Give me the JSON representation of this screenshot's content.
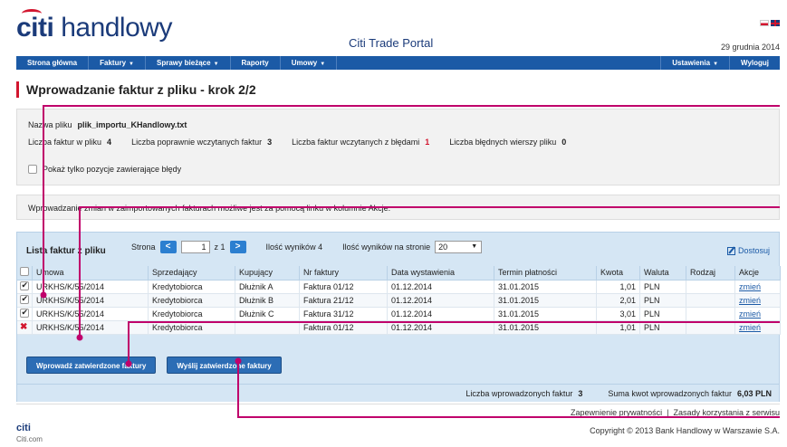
{
  "header": {
    "logo_citi": "citi",
    "logo_rest": " handlowy",
    "portal_title": "Citi Trade Portal",
    "date": "29 grudnia 2014"
  },
  "nav": {
    "items": [
      "Strona główna",
      "Faktury",
      "Sprawy bieżące",
      "Raporty",
      "Umowy"
    ],
    "dropdown": [
      false,
      true,
      true,
      false,
      true
    ],
    "right_items": [
      "Ustawienia",
      "Wyloguj"
    ],
    "right_dropdown": [
      true,
      false
    ]
  },
  "page_title": "Wprowadzanie faktur z pliku - krok 2/2",
  "file_info": {
    "name_label": "Nazwa pliku",
    "name_value": "plik_importu_KHandlowy.txt",
    "stats": [
      {
        "label": "Liczba faktur w pliku",
        "value": "4"
      },
      {
        "label": "Liczba poprawnie wczytanych faktur",
        "value": "3"
      },
      {
        "label": "Liczba faktur wczytanych z błędami",
        "value": "1"
      },
      {
        "label": "Liczba błędnych wierszy pliku",
        "value": "0"
      }
    ],
    "checkbox_label": "Pokaż tylko pozycje zawierające błędy"
  },
  "info_text": "Wprowadzanie zmian w zaimportowanych fakturach możliwe jest za pomocą linku w kolumnie Akcje.",
  "grid": {
    "title": "Lista faktur z pliku",
    "page_label": "Strona",
    "page_value": "1",
    "page_of": "z 1",
    "results_label": "Ilość wyników 4",
    "per_page_label": "Ilość wyników na stronie",
    "per_page_value": "20",
    "adjust_label": "Dostosuj",
    "columns": [
      "Umowa",
      "Sprzedający",
      "Kupujący",
      "Nr faktury",
      "Data wystawienia",
      "Termin płatności",
      "Kwota",
      "Waluta",
      "Rodzaj",
      "Akcje"
    ],
    "rows": [
      {
        "status": "checked",
        "umowa": "URKHS/K/55/2014",
        "sprzedajacy": "Kredytobiorca",
        "kupujacy": "Dłużnik A",
        "nr": "Faktura 01/12",
        "data": "01.12.2014",
        "termin": "31.01.2015",
        "kwota": "1,01",
        "waluta": "PLN",
        "rodzaj": "",
        "akcja": "zmień"
      },
      {
        "status": "checked",
        "umowa": "URKHS/K/55/2014",
        "sprzedajacy": "Kredytobiorca",
        "kupujacy": "Dłużnik B",
        "nr": "Faktura 21/12",
        "data": "01.12.2014",
        "termin": "31.01.2015",
        "kwota": "2,01",
        "waluta": "PLN",
        "rodzaj": "",
        "akcja": "zmień"
      },
      {
        "status": "checked",
        "umowa": "URKHS/K/55/2014",
        "sprzedajacy": "Kredytobiorca",
        "kupujacy": "Dłużnik C",
        "nr": "Faktura 31/12",
        "data": "01.12.2014",
        "termin": "31.01.2015",
        "kwota": "3,01",
        "waluta": "PLN",
        "rodzaj": "",
        "akcja": "zmień"
      },
      {
        "status": "error",
        "umowa": "URKHS/K/55/2014",
        "sprzedajacy": "Kredytobiorca",
        "kupujacy": "",
        "nr": "Faktura 01/12",
        "data": "01.12.2014",
        "termin": "31.01.2015",
        "kwota": "1,01",
        "waluta": "PLN",
        "rodzaj": "",
        "akcja": "zmień"
      }
    ],
    "btn_submit": "Wprowadź zatwierdzone faktury",
    "btn_send": "Wyślij zatwierdzone faktury",
    "sum_count_label": "Liczba wprowadzonych faktur",
    "sum_count_value": "3",
    "sum_amount_label": "Suma kwot wprowadzonych faktur",
    "sum_amount_value": "6,03 PLN"
  },
  "footer": {
    "logo": "citi",
    "logo_sub": "Citi.com",
    "link_privacy": "Zapewnienie prywatności",
    "separator": "|",
    "link_terms": "Zasady korzystania z serwisu",
    "copyright": "Copyright © 2013 Bank Handlowy w Warszawie S.A."
  },
  "colors": {
    "brand_blue": "#1b3b7a",
    "nav_blue": "#1b5aa6",
    "accent_red": "#d2162f",
    "callout_magenta": "#c0006b"
  }
}
